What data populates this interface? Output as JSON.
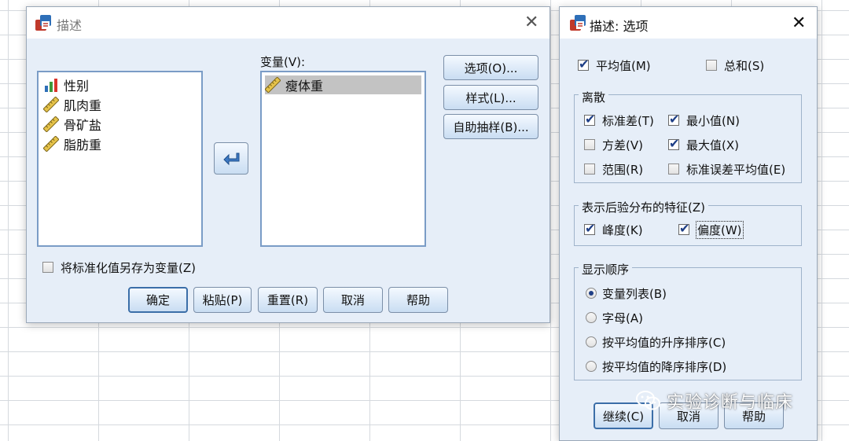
{
  "main_dialog": {
    "title": "描述",
    "source_vars": [
      "性别",
      "肌肉重",
      "骨矿盐",
      "脂肪重"
    ],
    "variables_label": "变量(V):",
    "target_vars": [
      "瘦体重"
    ],
    "side_buttons": [
      "选项(O)...",
      "样式(L)...",
      "自助抽样(B)..."
    ],
    "save_std_label": "将标准化值另存为变量(Z)",
    "bottom_buttons": [
      "确定",
      "粘贴(P)",
      "重置(R)",
      "取消",
      "帮助"
    ]
  },
  "options_dialog": {
    "title": "描述: 选项",
    "mean_label": "平均值(M)",
    "sum_label": "总和(S)",
    "dispersion": {
      "title": "离散",
      "std_dev": "标准差(T)",
      "minimum": "最小值(N)",
      "variance": "方差(V)",
      "maximum": "最大值(X)",
      "range": "范围(R)",
      "se_mean": "标准误差平均值(E)"
    },
    "distribution": {
      "title": "表示后验分布的特征(Z)",
      "kurtosis": "峰度(K)",
      "skewness": "偏度(W)"
    },
    "display_order": {
      "title": "显示顺序",
      "options": [
        "变量列表(B)",
        "字母(A)",
        "按平均值的升序排序(C)",
        "按平均值的降序排序(D)"
      ],
      "selected": "变量列表(B)"
    },
    "buttons": [
      "继续(C)",
      "取消",
      "帮助"
    ]
  },
  "checkbox_state": {
    "mean": true,
    "sum": false,
    "std_dev": true,
    "minimum": true,
    "variance": false,
    "maximum": true,
    "range": false,
    "se_mean": false,
    "kurtosis": true,
    "skewness": true,
    "save_std": false
  },
  "watermark": "实验诊断与临床",
  "colors": {
    "dialog_bg": "#e6eef8",
    "list_border": "#7a9cc6",
    "check": "#1f3f86",
    "nominal_icon_red": "#d9342b"
  }
}
